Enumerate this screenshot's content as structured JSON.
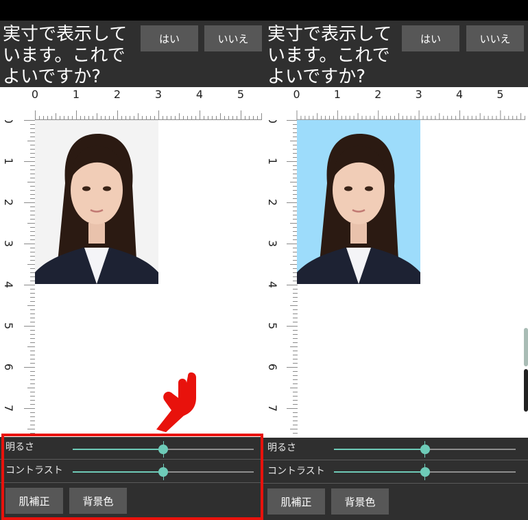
{
  "colors": {
    "accent": "#6ecbb8",
    "dialog_bg": "#2f2f2f",
    "button_bg": "#575757",
    "highlight": "#e8120c",
    "photo_bg_left": "#f3f3f3",
    "photo_bg_right": "#9ddcfb"
  },
  "dialog": {
    "question": "実寸で表示して\nいます。これで\nよいですか?",
    "yes_label": "はい",
    "no_label": "いいえ"
  },
  "ruler": {
    "horizontal_labels": [
      "0",
      "1",
      "2",
      "3",
      "4",
      "5"
    ],
    "vertical_labels": [
      "0",
      "1",
      "2",
      "3",
      "4",
      "5",
      "6",
      "7"
    ]
  },
  "controls": {
    "brightness_label": "明るさ",
    "brightness_value": 0.5,
    "contrast_label": "コントラスト",
    "contrast_value": 0.5,
    "skin_button": "肌補正",
    "background_button": "背景色"
  },
  "annotation": {
    "pointer_icon": "hand-pointer-icon",
    "highlight_target": "controls"
  }
}
